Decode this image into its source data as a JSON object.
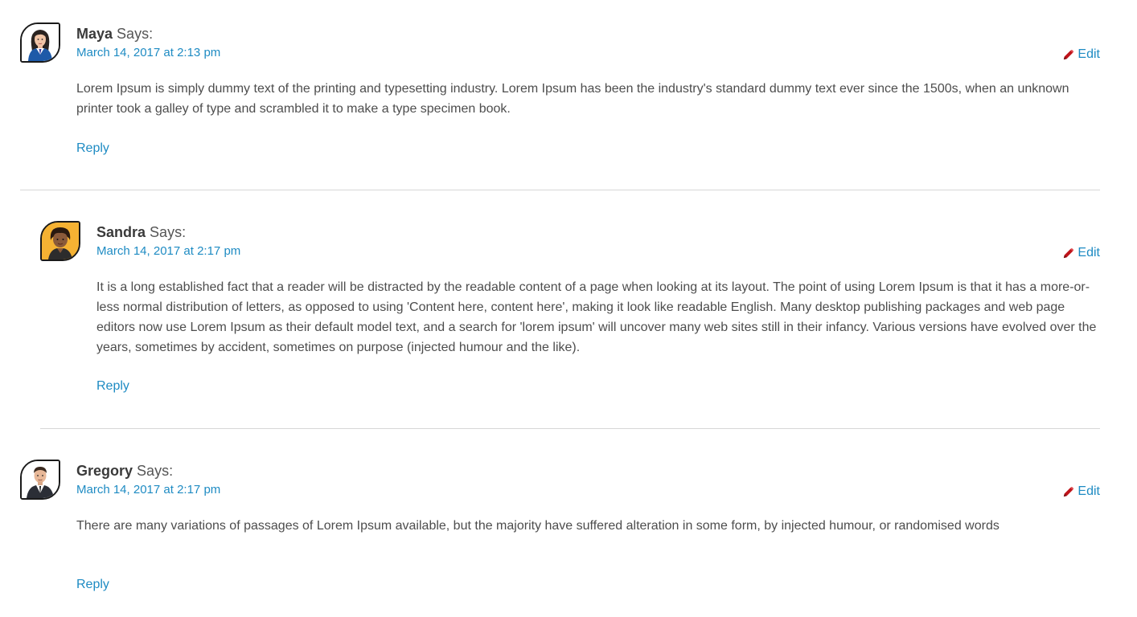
{
  "says_label": "Says:",
  "edit_label": "Edit",
  "reply_label": "Reply",
  "colors": {
    "link": "#1e8bc3",
    "edit_icon": "#c0141b",
    "divider": "#d6d6d6"
  },
  "icons": {
    "edit": "pencil-icon"
  },
  "comments": [
    {
      "author": "Maya",
      "date": "March 14, 2017 at 2:13 pm",
      "text": "Lorem Ipsum is simply dummy text of the printing and typesetting industry. Lorem Ipsum has been the industry's standard dummy text ever since the 1500s, when an unknown printer took a galley of type and scrambled it to make a type specimen book."
    },
    {
      "author": "Sandra",
      "date": "March 14, 2017 at 2:17 pm",
      "text": "It is a long established fact that a reader will be distracted by the readable content of a page when looking at its layout. The point of using Lorem Ipsum is that it has a more-or-less normal distribution of letters, as opposed to using 'Content here, content here', making it look like readable English. Many desktop publishing packages and web page editors now use Lorem Ipsum as their default model text, and a search for 'lorem ipsum' will uncover many web sites still in their infancy. Various versions have evolved over the years, sometimes by accident, sometimes on purpose (injected humour and the like)."
    },
    {
      "author": "Gregory",
      "date": "March 14, 2017 at 2:17 pm",
      "text": "There are many variations of passages of Lorem Ipsum available, but the majority have suffered alteration in some form, by injected humour, or randomised words"
    }
  ]
}
